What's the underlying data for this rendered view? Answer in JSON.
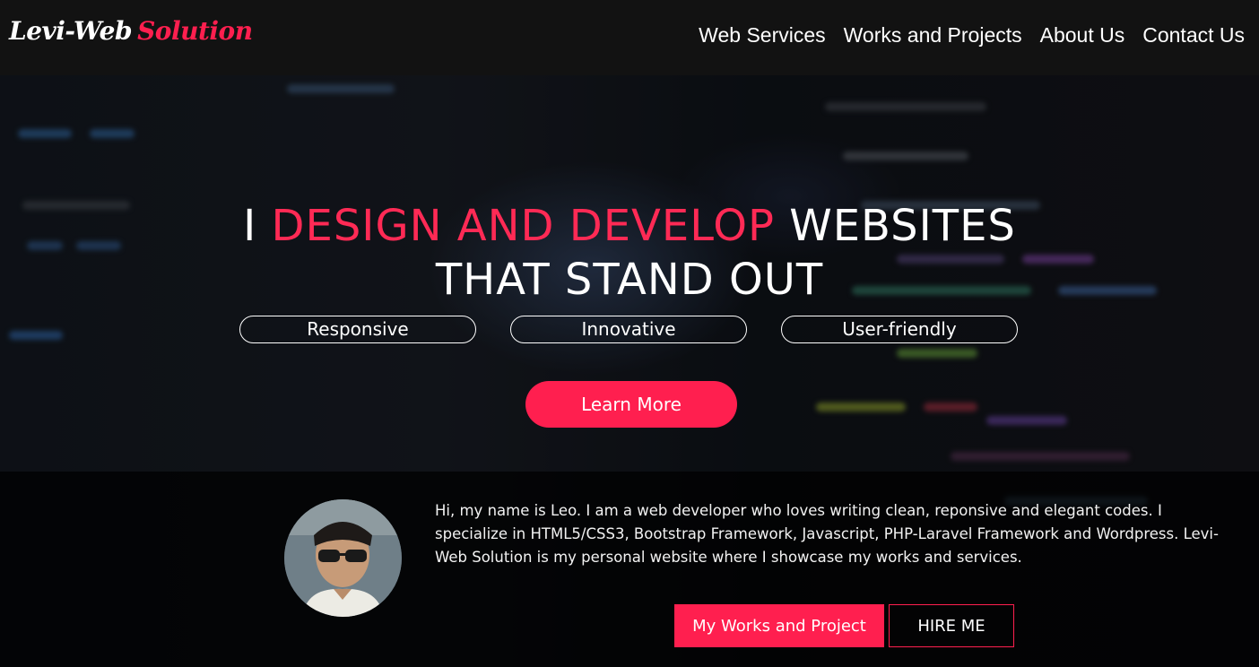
{
  "brand": {
    "part1": "Levi-Web",
    "part2": "Solution"
  },
  "nav": {
    "items": [
      "Web Services",
      "Works and Projects",
      "About Us",
      "Contact Us"
    ]
  },
  "hero": {
    "headline_prefix": "I",
    "headline_accent": "DESIGN AND DEVELOP",
    "headline_suffix": "WEBSITES",
    "headline_line2": "THAT STAND OUT",
    "pills": [
      "Responsive",
      "Innovative",
      "User-friendly"
    ],
    "cta_label": "Learn More"
  },
  "about": {
    "text": "Hi, my name is Leo. I am a web developer who loves writing clean, reponsive and elegant codes. I specialize in HTML5/CSS3, Bootstrap Framework, Javascript, PHP-Laravel Framework and Wordpress. Levi-Web Solution is my personal website where I showcase my works and services.",
    "works_button": "My Works and Project",
    "hire_button": "HIRE ME"
  },
  "colors": {
    "accent": "#ff1f4f",
    "header_bg": "#121212"
  }
}
